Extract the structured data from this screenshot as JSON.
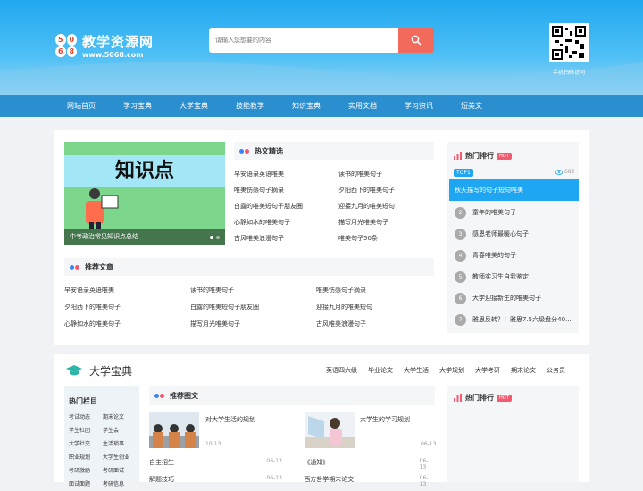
{
  "brand": {
    "badge": [
      "5",
      "0",
      "6",
      "8"
    ],
    "title": "教学资源网",
    "url": "www.5068.com"
  },
  "search": {
    "placeholder": "请输入您想要的内容"
  },
  "qr": {
    "caption": "手机扫码访问"
  },
  "nav": [
    "网站首页",
    "学习宝典",
    "大学宝典",
    "技能教学",
    "知识宝典",
    "实用文档",
    "学习资讯",
    "短美文"
  ],
  "slider": {
    "banner": "知识点",
    "caption": "中考政治常见知识点总结"
  },
  "hot_pick": {
    "title": "热文精选",
    "items": [
      "早安语录英语唯美",
      "读书的唯美句子",
      "唯美伤感句子摘录",
      "夕阳西下的唯美句子",
      "白露的唯美短句子朋友圈",
      "迎接九月的唯美短句",
      "心静如水的唯美句子",
      "描写月光唯美句子",
      "古风唯美浪漫句子",
      "唯美句子50条"
    ]
  },
  "recommend": {
    "title": "推荐文章",
    "items": [
      "早安语录英语唯美",
      "读书的唯美句子",
      "唯美伤感句子摘录",
      "夕阳西下的唯美句子",
      "白露的唯美短句子朋友圈",
      "迎接九月的唯美短句",
      "心静如水的唯美句子",
      "描写月光唯美句子",
      "古风唯美浪漫句子"
    ]
  },
  "ranking": {
    "title": "热门排行",
    "badge": "HOT",
    "top_label": "TOP1",
    "top_views": "682",
    "top_item": "秋天描写的句子短句唯美",
    "items": [
      {
        "num": "2",
        "text": "童年的唯美句子"
      },
      {
        "num": "3",
        "text": "感恩老师最暖心句子"
      },
      {
        "num": "4",
        "text": "青春唯美的句子"
      },
      {
        "num": "5",
        "text": "教师实习生自我鉴定"
      },
      {
        "num": "6",
        "text": "大学迎接新生的唯美句子"
      },
      {
        "num": "7",
        "text": "雅思反转？！雅思7.5六级盘分40..."
      }
    ]
  },
  "college": {
    "title": "大学宝典",
    "tabs": [
      "英语四六级",
      "毕业论文",
      "大学生活",
      "大学规划",
      "大学考研",
      "期末论文",
      "公务员"
    ],
    "hot_col_title": "热门栏目",
    "hot_cols": [
      "考试动态",
      "期末论文",
      "学生社团",
      "学生会",
      "大学社交",
      "生活琐事",
      "职业规划",
      "大学生创业",
      "考研激励",
      "考研面试",
      "面试面题",
      "考研信息"
    ],
    "rec_title": "推荐图文",
    "cards": [
      {
        "title": "对大学生活的规划",
        "date": "10-13"
      },
      {
        "title": "大学生的学习规划",
        "date": "06-13"
      }
    ],
    "list": [
      {
        "title": "自主招生",
        "date": "06-13"
      },
      {
        "title": "《通知》",
        "date": "06-13"
      },
      {
        "title": "解题技巧",
        "date": "06-13"
      },
      {
        "title": "西方哲学期末论文",
        "date": "06-13"
      }
    ],
    "ranking_title": "热门排行",
    "ranking_badge": "HOT"
  },
  "colors": {
    "accent": "#f26a5b",
    "nav": "#2b8fcf",
    "hot": "#f4596f",
    "top": "#1ea6f2"
  }
}
